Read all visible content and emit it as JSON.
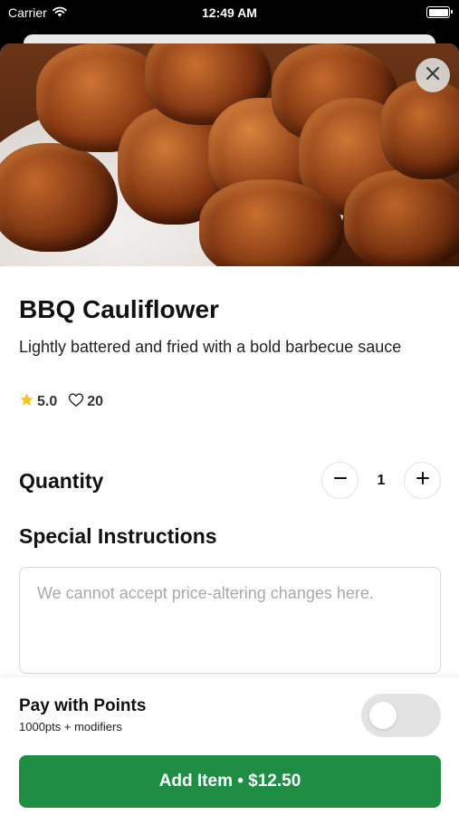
{
  "status_bar": {
    "carrier": "Carrier",
    "time": "12:49 AM",
    "wifi_icon": "wifi-icon",
    "battery_icon": "battery-icon"
  },
  "product": {
    "image_icon": "bbq-cauliflower-photo",
    "close_icon": "close-icon",
    "title": "BBQ Cauliflower",
    "description": "Lightly battered and fried with a bold barbecue sauce",
    "rating": "5.0",
    "rating_icon": "star-icon",
    "likes": "20",
    "likes_icon": "heart-icon"
  },
  "quantity": {
    "label": "Quantity",
    "value": "1",
    "decrement_icon": "minus-icon",
    "increment_icon": "plus-icon"
  },
  "instructions": {
    "label": "Special Instructions",
    "placeholder": "We cannot accept price-altering changes here.",
    "value": ""
  },
  "footer": {
    "points_title": "Pay with Points",
    "points_subtitle": "1000pts + modifiers",
    "points_toggle_on": false,
    "add_button_label": "Add Item • $12.50"
  },
  "colors": {
    "primary_green": "#1f8d43",
    "star_yellow": "#f5c11a",
    "toggle_off": "#e3e3e3"
  }
}
